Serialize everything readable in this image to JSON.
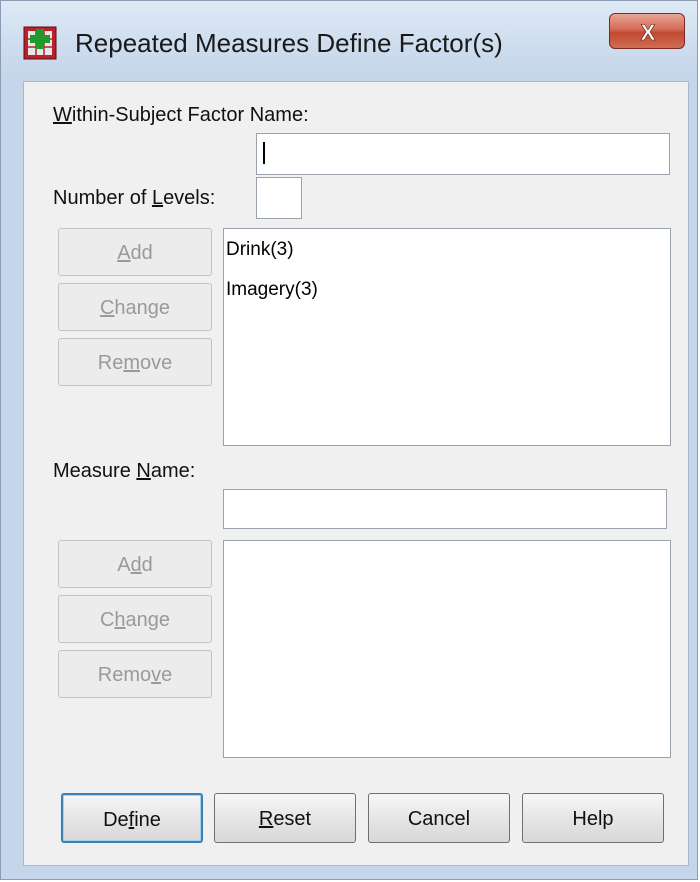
{
  "window": {
    "title": "Repeated Measures Define Factor(s)",
    "close_glyph": "X"
  },
  "factor": {
    "name_label": [
      "W",
      "ithin-Subject Factor Name:"
    ],
    "name_value": "",
    "levels_label": [
      "Number of ",
      "L",
      "evels:"
    ],
    "levels_value": "",
    "buttons": {
      "add": [
        "",
        "A",
        "dd"
      ],
      "change": [
        "",
        "C",
        "hange"
      ],
      "remove": [
        "Re",
        "m",
        "ove"
      ]
    },
    "items": [
      "Drink(3)",
      "Imagery(3)"
    ]
  },
  "measure": {
    "name_label": [
      "Measure ",
      "N",
      "ame:"
    ],
    "name_value": "",
    "buttons": {
      "add": [
        "A",
        "d",
        "d"
      ],
      "change": [
        "C",
        "h",
        "ange"
      ],
      "remove": [
        "Remo",
        "v",
        "e"
      ]
    },
    "items": []
  },
  "footer": {
    "define": [
      "De",
      "f",
      "ine"
    ],
    "reset": [
      "",
      "R",
      "eset"
    ],
    "cancel": "Cancel",
    "help": "Help"
  },
  "colors": {
    "title_bg": "#cddcee",
    "close_button": "#c9533c",
    "client_bg": "#f0f0f0",
    "default_button_border": "#3c7fb1"
  },
  "icons": {
    "app": "spss-define-factor-icon",
    "close": "close-icon"
  }
}
